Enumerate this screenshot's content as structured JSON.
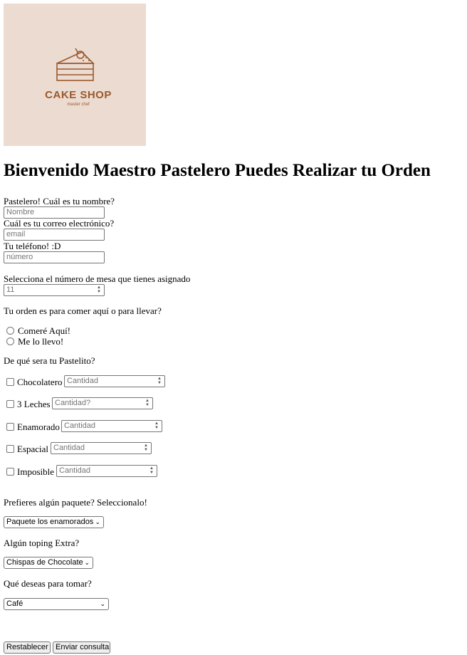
{
  "logo": {
    "brand": "CAKE SHOP",
    "tagline": "master chef"
  },
  "title": "Bienvenido Maestro Pastelero Puedes Realizar tu Orden",
  "form": {
    "name_label": "Pastelero! Cuál es tu nombre?",
    "name_placeholder": "Nombre",
    "email_label": "Cuál es tu correo electrónico?",
    "email_placeholder": "email",
    "phone_label": "Tu teléfono! :D",
    "phone_placeholder": "número",
    "table_label": "Selecciona el número de mesa que tienes asignado",
    "table_value": "11",
    "order_type_label": "Tu orden es para comer aquí o para llevar?",
    "order_type_options": [
      "Comeré Aquí!",
      "Me lo llevo!"
    ],
    "cake_label": "De qué sera tu Pastelito?",
    "cakes": [
      {
        "name": "Chocolatero",
        "placeholder": "Cantidad"
      },
      {
        "name": "3 Leches",
        "placeholder": "Cantidad?"
      },
      {
        "name": "Enamorado",
        "placeholder": "Cantidad"
      },
      {
        "name": "Espacial",
        "placeholder": "Cantidad"
      },
      {
        "name": "Imposible",
        "placeholder": "Cantidad"
      }
    ],
    "package_label": "Prefieres algún paquete? Seleccionalo!",
    "package_selected": "Paquete los enamorados",
    "topping_label": "Algún toping Extra?",
    "topping_selected": "Chispas de Chocolate",
    "drink_label": "Qué deseas para tomar?",
    "drink_selected": "Café",
    "reset_button": "Restablecer",
    "submit_button": "Enviar consulta"
  },
  "colors": {
    "logo_bg": "#ecdbd0",
    "logo_ink": "#9a5a2e"
  }
}
